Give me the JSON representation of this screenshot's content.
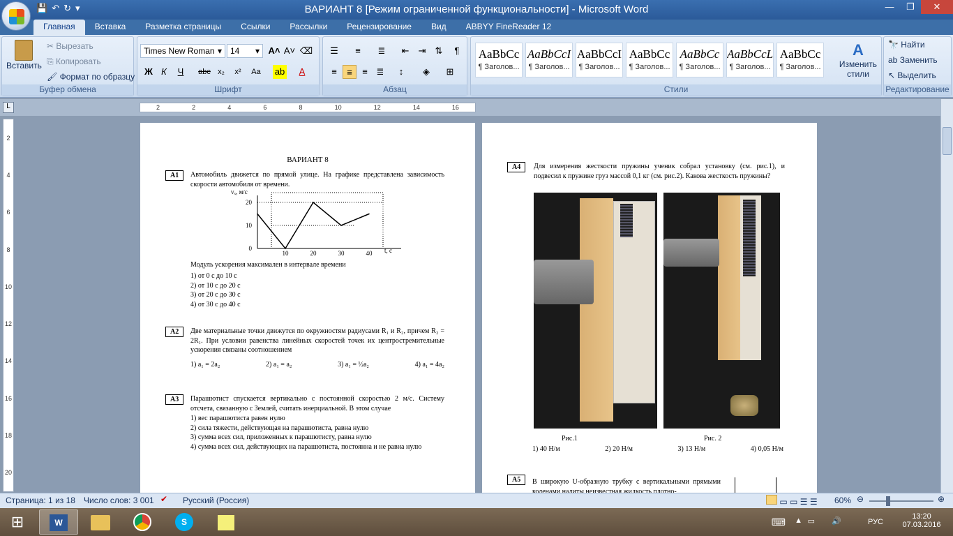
{
  "window": {
    "title": "ВАРИАНТ 8 [Режим ограниченной функциональности] - Microsoft Word"
  },
  "tabs": [
    "Главная",
    "Вставка",
    "Разметка страницы",
    "Ссылки",
    "Рассылки",
    "Рецензирование",
    "Вид",
    "ABBYY FineReader 12"
  ],
  "clipboard": {
    "paste": "Вставить",
    "cut": "Вырезать",
    "copy": "Копировать",
    "format_painter": "Формат по образцу",
    "label": "Буфер обмена"
  },
  "font": {
    "name": "Times New Roman",
    "size": "14",
    "label": "Шрифт"
  },
  "paragraph": {
    "label": "Абзац"
  },
  "styles": {
    "items": [
      {
        "sample": "AaBbCc",
        "name": "¶ Заголов..."
      },
      {
        "sample": "AaBbCcI",
        "name": "¶ Заголов..."
      },
      {
        "sample": "AaBbCcI",
        "name": "¶ Заголов..."
      },
      {
        "sample": "AaBbCc",
        "name": "¶ Заголов..."
      },
      {
        "sample": "AaBbCc",
        "name": "¶ Заголов..."
      },
      {
        "sample": "AaBbCcL",
        "name": "¶ Заголов..."
      },
      {
        "sample": "AaBbCc",
        "name": "¶ Заголов..."
      }
    ],
    "change": "Изменить стили",
    "label": "Стили"
  },
  "editing": {
    "find": "Найти",
    "replace": "Заменить",
    "select": "Выделить",
    "label": "Редактирование"
  },
  "ruler": {
    "h_ticks": [
      "2",
      "2",
      "4",
      "6",
      "8",
      "10",
      "12",
      "14",
      "16"
    ],
    "v_ticks": [
      "2",
      "4",
      "6",
      "8",
      "10",
      "12",
      "14",
      "16",
      "18",
      "20"
    ]
  },
  "page1": {
    "title": "ВАРИАНТ 8",
    "a1": {
      "label": "A1",
      "text": "Автомобиль движется по прямой улице. На графике представлена зависимость скорости автомобиля от времени.",
      "question": "Модуль ускорения максимален в интервале времени",
      "options": [
        "1)  от 0 с до 10 с",
        "2)  от 10 с до 20 с",
        "3)  от 20 с до 30 с",
        "4)  от 30 с до 40 с"
      ]
    },
    "a2": {
      "label": "A2",
      "text": "Две материальные точки движутся по окружностям радиусами R₁ и R₂, причем R₂ = 2R₁. При условии равенства линейных скоростей точек их центростремительные ускорения связаны соотношением",
      "options": [
        "1)  a₁ = 2a₂",
        "2)  a₁ = a₂",
        "3)  a₁ = ½a₂",
        "4)  a₁ = 4a₂"
      ]
    },
    "a3": {
      "label": "A3",
      "text": "Парашютист спускается вертикально с постоянной скоростью 2 м/с. Систему отсчета, связанную с Землей, считать инерциальной. В этом случае",
      "options": [
        "1)  вес парашютиста равен нулю",
        "2)  сила тяжести, действующая на парашютиста, равна нулю",
        "3)  сумма всех сил, приложенных к парашютисту, равна нулю",
        "4)  сумма всех сил, действующих на парашютиста, постоянна и не равна нулю"
      ]
    }
  },
  "chart_data": {
    "type": "line",
    "x": [
      0,
      10,
      20,
      30,
      40
    ],
    "y": [
      15,
      0,
      20,
      10,
      15
    ],
    "xlabel": "t, с",
    "ylabel": "vₓ, м/с",
    "ylim": [
      0,
      20
    ],
    "xticks": [
      "10",
      "20",
      "30",
      "40"
    ],
    "yticks": [
      "0",
      "10",
      "20"
    ]
  },
  "page2": {
    "a4": {
      "label": "A4",
      "text": "Для измерения жесткости пружины ученик собрал установку (см. рис.1), и подвесил к пружине груз массой 0,1 кг (см. рис.2). Какова жесткость пружины?",
      "fig1": "Рис.1",
      "fig2": "Рис. 2",
      "options": [
        "1)  40 Н/м",
        "2)  20 Н/м",
        "3)  13 Н/м",
        "4)  0,05 Н/м"
      ]
    },
    "a5": {
      "label": "A5",
      "text": "В широкую U-образную трубку с вертикальными прямыми коленами налиты неизвестная жидкость плотно-"
    }
  },
  "status": {
    "page": "Страница: 1 из 18",
    "words": "Число слов: 3 001",
    "lang": "Русский (Россия)",
    "zoom": "60%"
  },
  "tray": {
    "lang": "РУС",
    "time": "13:20",
    "date": "07.03.2016"
  }
}
